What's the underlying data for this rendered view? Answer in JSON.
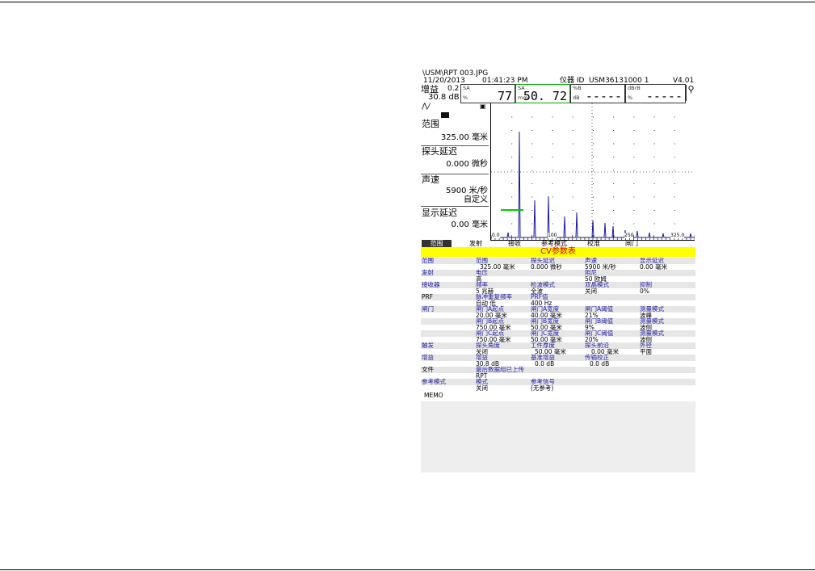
{
  "screen": {
    "filepath": "\\USM\\RPT 003.JPG",
    "date": "11/20/2013",
    "time": "01:41:23 PM",
    "device_id_label": "仪器 ID",
    "device_id": "USM36131000 1",
    "version": "V4.01",
    "gain_label": "增益",
    "gain_step": "0.2",
    "gain_value": "30.8 dB",
    "readouts": [
      {
        "label_top": "SA",
        "label_bottom": "%",
        "value": "77"
      },
      {
        "label_top": "SA",
        "label_bottom": "mm",
        "value": "50. 72"
      },
      {
        "label_top": "%B",
        "label_bottom": "dB",
        "value": "-----"
      },
      {
        "label_top": "dBrB",
        "label_bottom": "%",
        "value": "-----"
      }
    ],
    "left_panel": [
      {
        "title": "范围",
        "value": "325.00 毫米",
        "extra": ""
      },
      {
        "title": "探头延迟",
        "value": "0.000 微秒",
        "extra": ""
      },
      {
        "title": "声速",
        "value": "5900 米/秒",
        "extra": "自定义"
      },
      {
        "title": "显示延迟",
        "value": "0.00 毫米",
        "extra": ""
      }
    ],
    "x_axis_ticks": [
      "0.0",
      "100",
      "250",
      "325.0"
    ],
    "tabs": [
      "范围",
      "发射",
      "接收",
      "参考模式",
      "校准",
      "闸门"
    ],
    "active_tab": 0,
    "cv_title": "CV参数表",
    "memo": "MEMO",
    "colors": {
      "cv_bar": "#ffff00",
      "cv_text": "#d00000",
      "labels": "#1a1aa0",
      "signal": "#1a1aa0",
      "gate": "#00cc00"
    },
    "table": [
      {
        "section": "范围",
        "shade": true,
        "labels": [
          "范围",
          "探头延迟",
          "声速",
          "显示延迟"
        ],
        "values": [
          "325.00 毫米",
          "0.000 微秒",
          "5900 米/秒",
          "0.00 毫米"
        ]
      },
      {
        "section": "发射",
        "shade": true,
        "labels": [
          "电压",
          "",
          "阻尼",
          ""
        ],
        "values": [
          "高",
          "",
          "50 欧姆",
          ""
        ]
      },
      {
        "section": "接收器",
        "shade": true,
        "labels": [
          "频率",
          "检波模式",
          "双晶模式",
          "抑制"
        ],
        "values": [
          "5 兆赫",
          "全波",
          "关闭",
          "0%"
        ]
      },
      {
        "section": "PRF",
        "shade": true,
        "labels": [
          "脉冲重复频率",
          "PRF值",
          "",
          ""
        ],
        "values": [
          "自动 低",
          "400 Hz",
          "",
          ""
        ]
      },
      {
        "section": "闸门",
        "shade": true,
        "labels": [
          "闸门A起点",
          "闸门A宽度",
          "闸门A阈值",
          "测量模式"
        ],
        "values": [
          "20.00 毫米",
          "40.00 毫米",
          "21%",
          "波峰"
        ]
      },
      {
        "section": "",
        "shade": true,
        "labels": [
          "闸门B起点",
          "闸门B宽度",
          "闸门B阈值",
          "测量模式"
        ],
        "values": [
          "750.00 毫米",
          "50.00 毫米",
          "9%",
          "波侧"
        ]
      },
      {
        "section": "",
        "shade": true,
        "labels": [
          "闸门C起点",
          "闸门C宽度",
          "闸门C阈值",
          "测量模式"
        ],
        "values": [
          "750.00 毫米",
          "50.00 毫米",
          "20%",
          "波侧"
        ]
      },
      {
        "section": "触发",
        "shade": true,
        "labels": [
          "探头角度",
          "工件厚度",
          "探头前沿",
          "外径"
        ],
        "values": [
          "关闭",
          "50.00 毫米",
          "0.00 毫米",
          "平面"
        ]
      },
      {
        "section": "增益",
        "shade": true,
        "labels": [
          "增益",
          "基准增益",
          "传输校正",
          ""
        ],
        "values": [
          "30.8 dB",
          "0.0 dB",
          "0.0 dB",
          ""
        ]
      },
      {
        "section": "文件",
        "shade": true,
        "labels": [
          "最后数据组已上传",
          "",
          "",
          ""
        ],
        "values": [
          "RPT",
          "",
          "",
          ""
        ]
      },
      {
        "section": "参考模式",
        "shade": true,
        "labels": [
          "模式",
          "参考信号",
          "",
          ""
        ],
        "values": [
          "关闭",
          "(无参考)",
          "",
          ""
        ]
      }
    ]
  }
}
